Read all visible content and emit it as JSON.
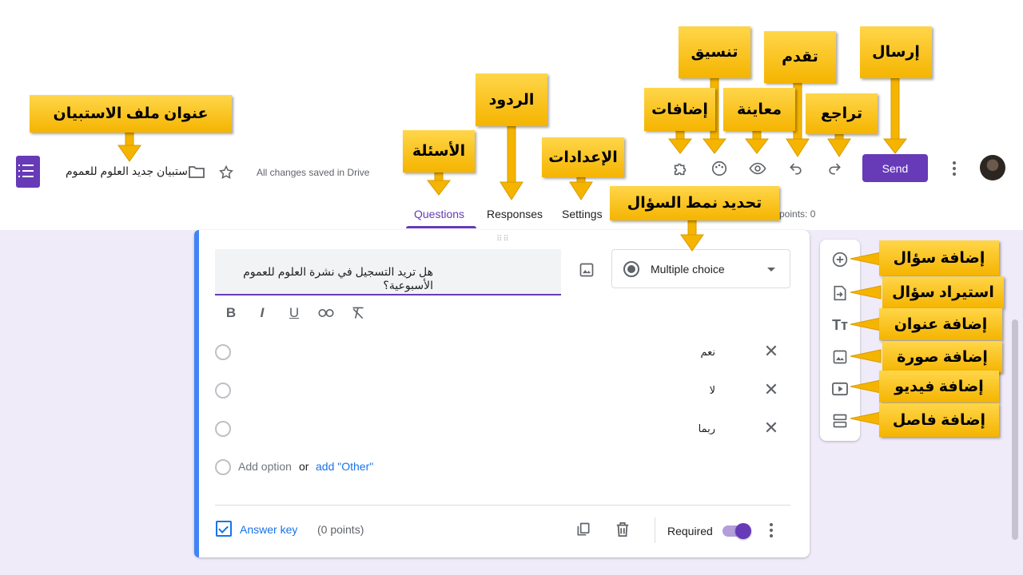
{
  "header": {
    "document_title": "استبيان جديد العلوم للعموم",
    "save_status": "All changes saved in Drive",
    "send_label": "Send"
  },
  "tabs": [
    {
      "label": "Questions"
    },
    {
      "label": "Responses"
    },
    {
      "label": "Settings"
    }
  ],
  "total_points": "points: 0",
  "question": {
    "text": "هل تريد التسجيل في نشرة العلوم للعموم الأسبوعية؟",
    "type": "Multiple choice",
    "options": [
      {
        "label": "نعم"
      },
      {
        "label": "لا"
      },
      {
        "label": "ربما"
      }
    ],
    "add_option": "Add option",
    "or": "or",
    "add_other": "add \"Other\"",
    "answer_key": "Answer key",
    "points": "(0 points)",
    "required": "Required",
    "required_on": true
  },
  "callouts": {
    "title_file": "عنوان ملف الاستبيان",
    "questions": "الأسئلة",
    "responses": "الردود",
    "settings": "الإعدادات",
    "addons": "إضافات",
    "format": "تنسيق",
    "preview": "معاينة",
    "forward": "تقدم",
    "undo": "تراجع",
    "send": "إرسال",
    "question_type": "تحديد نمط السؤال",
    "add_question": "إضافة سؤال",
    "import_question": "استيراد سؤال",
    "add_title": "إضافة عنوان",
    "add_image": "إضافة صورة",
    "add_video": "إضافة فيديو",
    "add_section": "إضافة فاصل"
  },
  "colors": {
    "accent": "#673ab7",
    "callout": "#ffc21b",
    "link": "#1a73e8",
    "page_bg": "#f0ebf8"
  }
}
